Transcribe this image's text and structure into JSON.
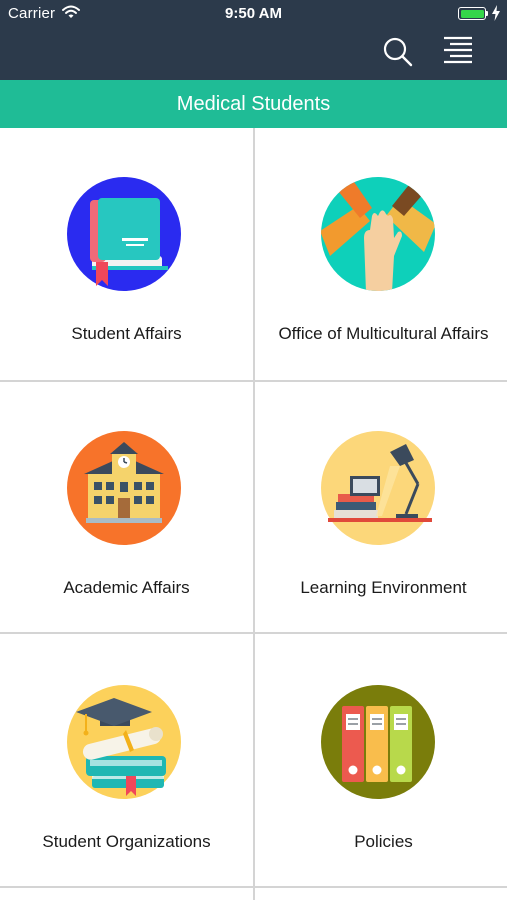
{
  "status_bar": {
    "carrier": "Carrier",
    "time": "9:50 AM",
    "battery_level": 1.0
  },
  "nav": {
    "search_icon": "search-icon",
    "menu_icon": "menu-icon"
  },
  "page": {
    "title": "Medical Students"
  },
  "colors": {
    "nav_background": "#2c3a4b",
    "title_bar": "#1fbc96",
    "divider": "#d4d4d4"
  },
  "tiles": [
    {
      "label": "Student Affairs",
      "icon": "book-icon"
    },
    {
      "label": "Office of Multicultural Affairs",
      "icon": "joined-hands-icon"
    },
    {
      "label": "Academic Affairs",
      "icon": "school-building-icon"
    },
    {
      "label": "Learning Environment",
      "icon": "desk-lamp-icon"
    },
    {
      "label": "Student Organizations",
      "icon": "graduation-cap-icon"
    },
    {
      "label": "Policies",
      "icon": "binders-icon"
    }
  ]
}
